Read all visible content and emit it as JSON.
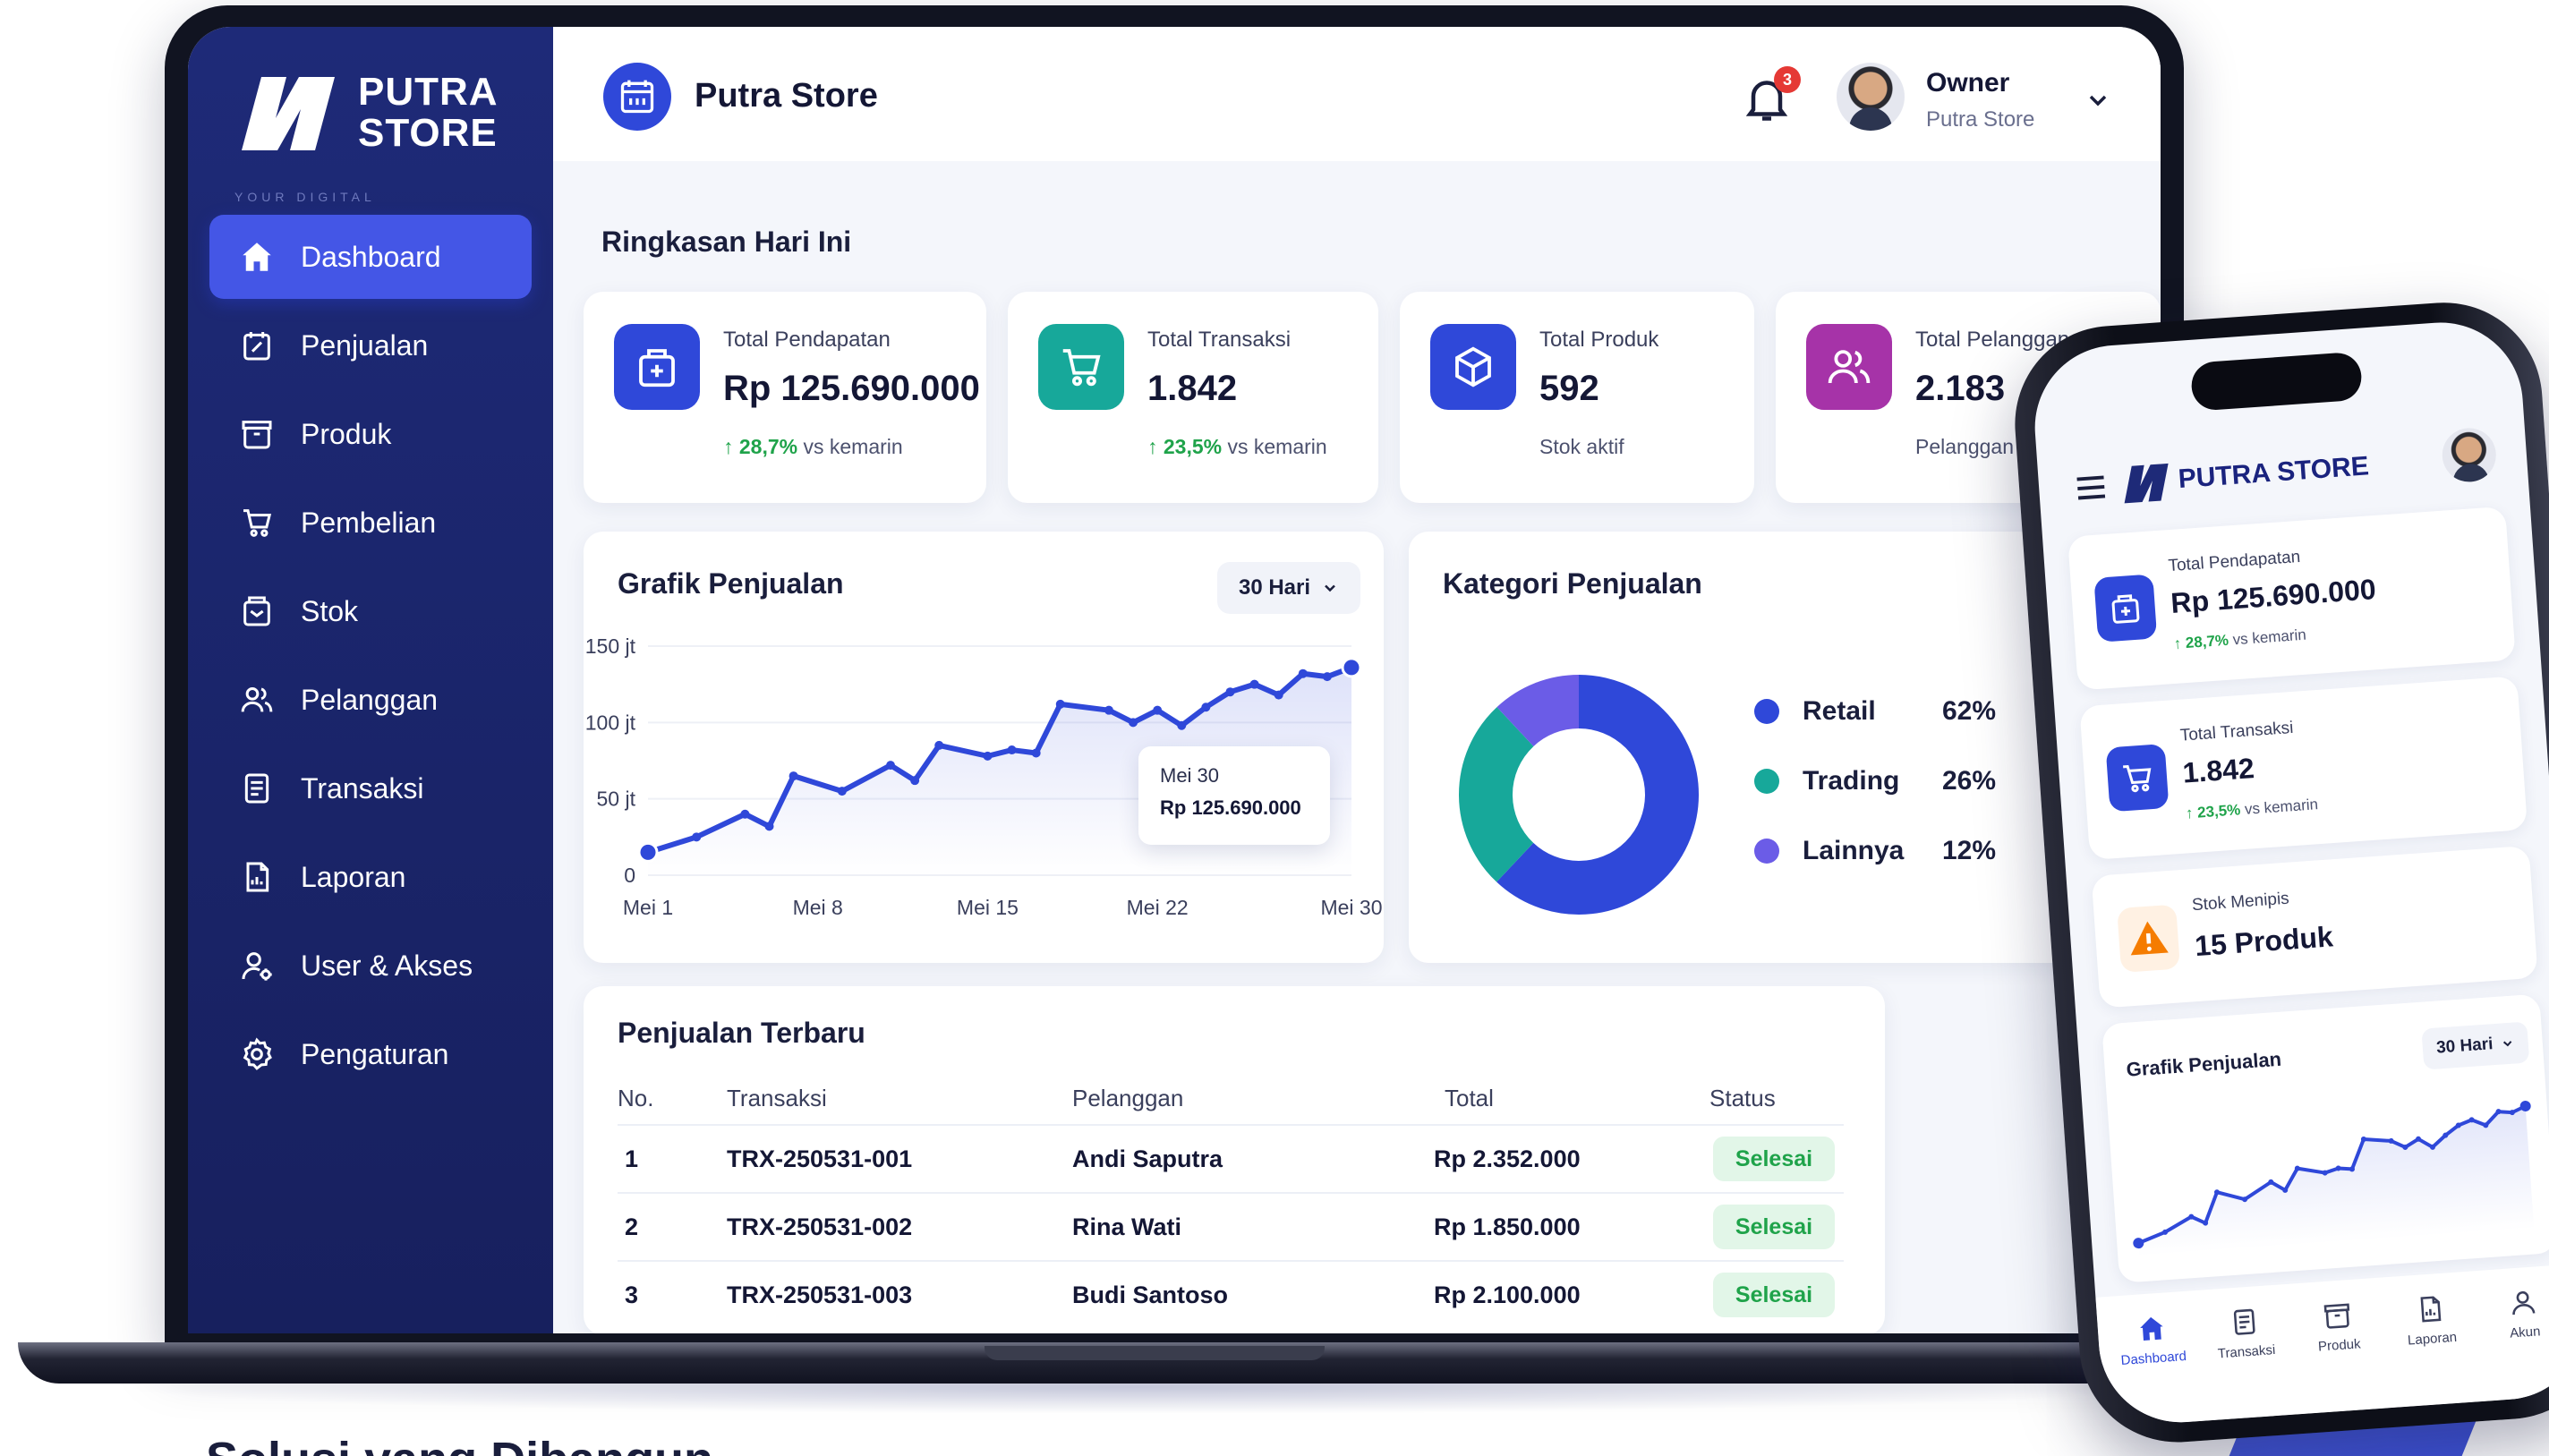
{
  "brand": {
    "line1": "PUTRA",
    "line2": "STORE",
    "tagline": "YOUR DIGITAL"
  },
  "sidebar": {
    "items": [
      {
        "label": "Dashboard",
        "icon": "home-icon",
        "active": true
      },
      {
        "label": "Penjualan",
        "icon": "sales-icon"
      },
      {
        "label": "Produk",
        "icon": "product-box-icon"
      },
      {
        "label": "Pembelian",
        "icon": "cart-icon"
      },
      {
        "label": "Stok",
        "icon": "stock-icon"
      },
      {
        "label": "Pelanggan",
        "icon": "customers-icon"
      },
      {
        "label": "Transaksi",
        "icon": "receipt-icon"
      },
      {
        "label": "Laporan",
        "icon": "report-icon"
      },
      {
        "label": "User & Akses",
        "icon": "user-access-icon"
      },
      {
        "label": "Pengaturan",
        "icon": "gear-icon"
      }
    ]
  },
  "header": {
    "store_name": "Putra Store",
    "notification_count": "3",
    "user_name": "Owner",
    "user_store": "Putra Store"
  },
  "summary": {
    "title": "Ringkasan Hari Ini",
    "cards": [
      {
        "label": "Total Pendapatan",
        "value": "Rp 125.690.000",
        "delta": "28,7%",
        "delta_suffix": "vs kemarin",
        "icon": "revenue-icon",
        "color": "#2f48d9"
      },
      {
        "label": "Total Transaksi",
        "value": "1.842",
        "delta": "23,5%",
        "delta_suffix": "vs kemarin",
        "icon": "cart-icon",
        "color": "#17a89a"
      },
      {
        "label": "Total Produk",
        "value": "592",
        "sub": "Stok aktif",
        "icon": "product-box-icon",
        "color": "#2f48d9"
      },
      {
        "label": "Total Pelanggan",
        "value": "2.183",
        "sub": "Pelanggan aktif",
        "icon": "customers-icon",
        "color": "#a633a8"
      }
    ]
  },
  "sales_chart": {
    "title": "Grafik Penjualan",
    "range": "30 Hari",
    "tooltip_date": "Mei 30",
    "tooltip_value": "Rp 125.690.000"
  },
  "chart_data": {
    "type": "line",
    "x_ticks": [
      "Mei 1",
      "Mei 8",
      "Mei 15",
      "Mei 22",
      "Mei 30"
    ],
    "y_ticks": [
      "0",
      "50 jt",
      "100 jt",
      "150 jt"
    ],
    "ylim": [
      0,
      150
    ],
    "x": [
      1,
      3,
      5,
      6,
      7,
      9,
      11,
      12,
      13,
      15,
      16,
      17,
      18,
      20,
      21,
      22,
      23,
      24,
      25,
      26,
      27,
      28,
      29,
      30
    ],
    "y": [
      15,
      25,
      40,
      32,
      65,
      55,
      72,
      62,
      85,
      78,
      82,
      80,
      112,
      108,
      100,
      108,
      98,
      110,
      120,
      125,
      118,
      132,
      130,
      136
    ]
  },
  "category_chart": {
    "title": "Kategori Penjualan",
    "type": "pie",
    "slices": [
      {
        "label": "Retail",
        "pct": "62%",
        "value": 62,
        "color": "#2f48d9"
      },
      {
        "label": "Trading",
        "pct": "26%",
        "value": 26,
        "color": "#17a89a"
      },
      {
        "label": "Lainnya",
        "pct": "12%",
        "value": 12,
        "color": "#6b5ce7"
      }
    ]
  },
  "recent_sales": {
    "title": "Penjualan Terbaru",
    "columns": [
      "No.",
      "Transaksi",
      "Pelanggan",
      "Total",
      "Status"
    ],
    "rows": [
      {
        "no": "1",
        "trx": "TRX-250531-001",
        "customer": "Andi Saputra",
        "total": "Rp 2.352.000",
        "status": "Selesai"
      },
      {
        "no": "2",
        "trx": "TRX-250531-002",
        "customer": "Rina Wati",
        "total": "Rp 1.850.000",
        "status": "Selesai"
      },
      {
        "no": "3",
        "trx": "TRX-250531-003",
        "customer": "Budi Santoso",
        "total": "Rp 2.100.000",
        "status": "Selesai"
      }
    ]
  },
  "mobile": {
    "brand": "PUTRA STORE",
    "cards": [
      {
        "label": "Total Pendapatan",
        "value": "Rp 125.690.000",
        "delta": "28,7%",
        "delta_suffix": "vs kemarin"
      },
      {
        "label": "Total Transaksi",
        "value": "1.842",
        "delta": "23,5%",
        "delta_suffix": "vs kemarin"
      },
      {
        "label": "Stok Menipis",
        "value": "15 Produk"
      }
    ],
    "chart_title": "Grafik Penjualan",
    "chart_range": "30 Hari",
    "nav": [
      "Dashboard",
      "Transaksi",
      "Produk",
      "Laporan",
      "Akun"
    ]
  },
  "caption": "Solusi yang Dibangun"
}
